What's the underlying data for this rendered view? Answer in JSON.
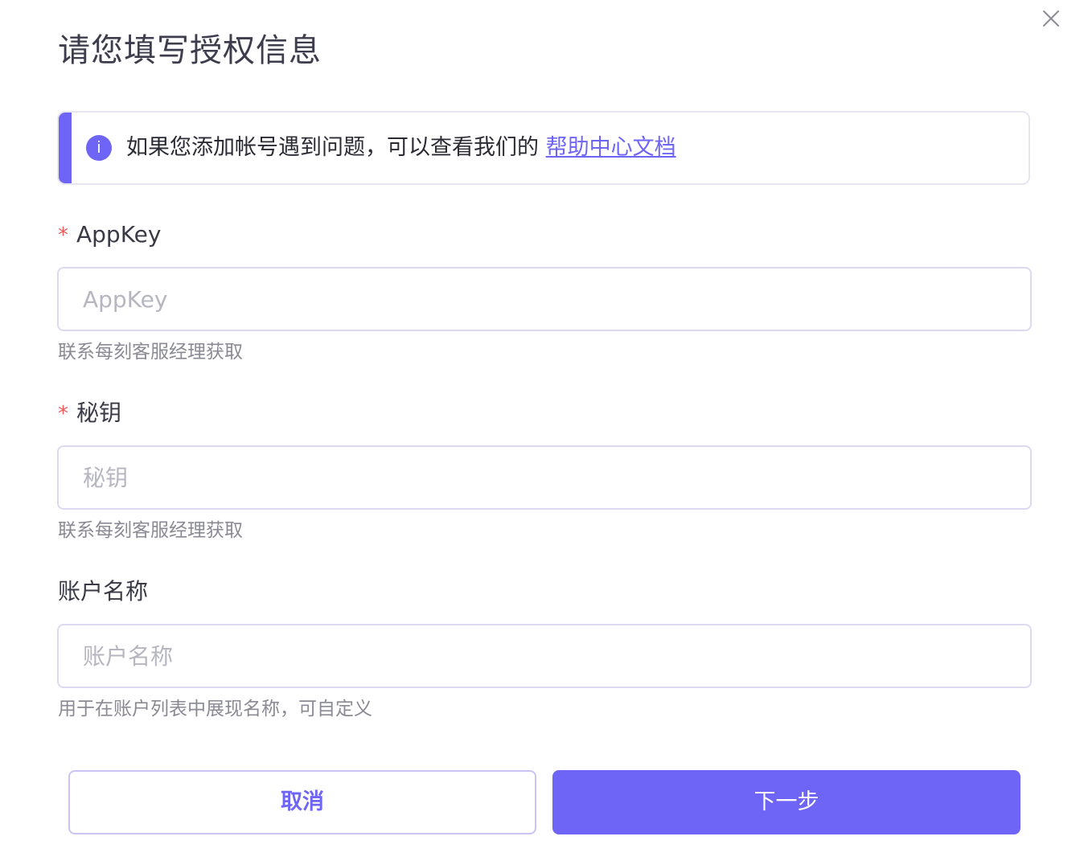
{
  "dialog": {
    "title": "请您填写授权信息",
    "close_icon": "close-icon"
  },
  "notice": {
    "icon": "info-icon",
    "icon_glyph": "i",
    "text": "如果您添加帐号遇到问题，可以查看我们的 ",
    "link_text": "帮助中心文档"
  },
  "fields": [
    {
      "label": "AppKey",
      "required_mark": "*",
      "placeholder": "AppKey",
      "value": "",
      "hint": "联系每刻客服经理获取"
    },
    {
      "label": "秘钥",
      "required_mark": "*",
      "placeholder": "秘钥",
      "value": "",
      "hint": "联系每刻客服经理获取"
    },
    {
      "label": "账户名称",
      "required_mark": "",
      "placeholder": "账户名称",
      "value": "",
      "hint": "用于在账户列表中展现名称，可自定义"
    }
  ],
  "buttons": {
    "cancel_label": "取消",
    "next_label": "下一步"
  },
  "colors": {
    "accent": "#6e64f5",
    "required": "#f05a5a",
    "input_border": "#dcdaf3",
    "hint_text": "#8a8a94"
  }
}
